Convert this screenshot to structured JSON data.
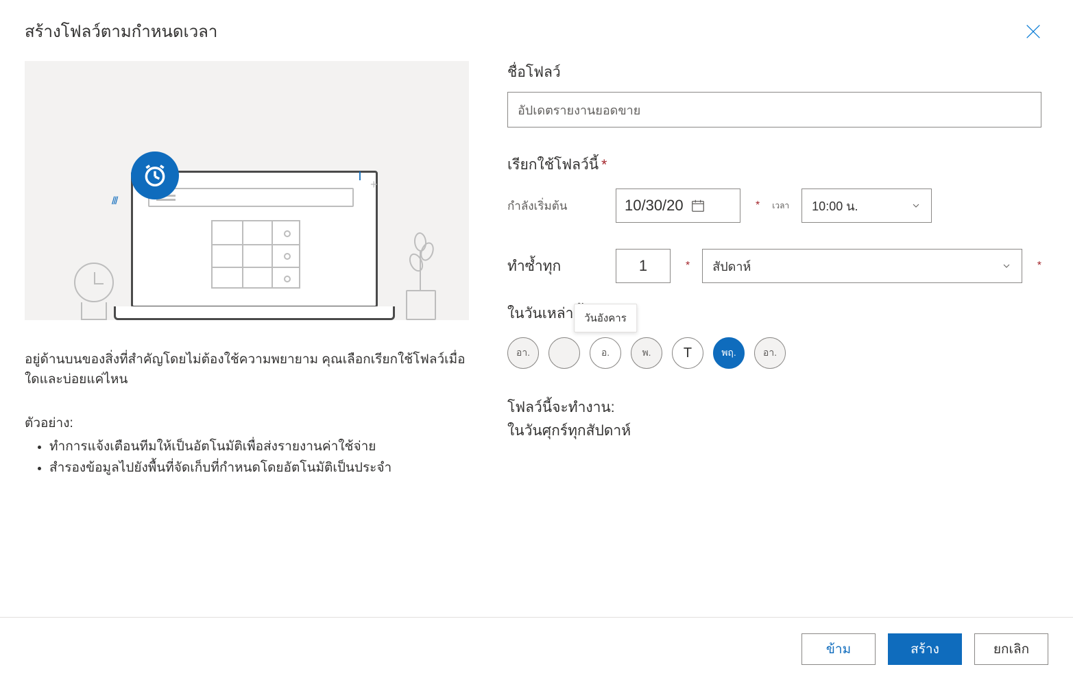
{
  "header": {
    "title": "สร้างโฟลว์ตามกำหนดเวลา"
  },
  "left": {
    "description": "อยู่ด้านบนของสิ่งที่สำคัญโดยไม่ต้องใช้ความพยายาม คุณเลือกเรียกใช้โฟลว์เมื่อใดและบ่อยแค่ไหน",
    "examples_title": "ตัวอย่าง:",
    "examples": [
      "ทำการแจ้งเตือนทีมให้เป็นอัตโนมัติเพื่อส่งรายงานค่าใช้จ่าย",
      "สำรองข้อมูลไปยังพื้นที่จัดเก็บที่กำหนดโดยอัตโนมัติเป็นประจำ"
    ]
  },
  "form": {
    "flow_name_label": "ชื่อโฟลว์",
    "flow_name_value": "อัปเดตรายงานยอดขาย",
    "run_flow_label": "เรียกใช้โฟลว์นี้",
    "starting_label": "กำลังเริ่มต้น",
    "start_date": "10/30/20",
    "time_label": "เวลา",
    "time_value": "10:00 น.",
    "repeat_label": "ทำซ้ำทุก",
    "repeat_count": "1",
    "repeat_unit": "สัปดาห์",
    "days_label": "ในวันเหล่านี้",
    "days": [
      {
        "abbr": "อา.",
        "selected": false,
        "state": ""
      },
      {
        "abbr": "",
        "selected": false,
        "state": ""
      },
      {
        "abbr": "อ.",
        "selected": false,
        "state": "hover",
        "tooltip": "วันอังคาร"
      },
      {
        "abbr": "พ.",
        "selected": false,
        "state": ""
      },
      {
        "abbr": "T",
        "selected": false,
        "state": "letter"
      },
      {
        "abbr": "พฤ.",
        "selected": true,
        "state": "active"
      },
      {
        "abbr": "อา.",
        "selected": false,
        "state": ""
      }
    ],
    "summary_title": "โฟลว์นี้จะทำงาน:",
    "summary_text": "ในวันศุกร์ทุกสัปดาห์"
  },
  "footer": {
    "skip": "ข้าม",
    "create": "สร้าง",
    "cancel": "ยกเลิก"
  }
}
